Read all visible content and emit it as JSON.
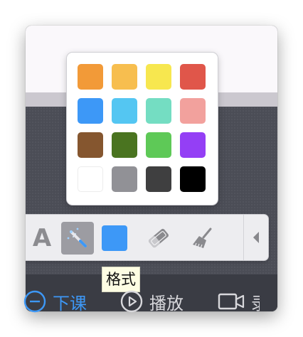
{
  "palette": {
    "colors": [
      "#f29a38",
      "#f7be4f",
      "#f7e74f",
      "#e0564a",
      "#3d98f7",
      "#54c6f2",
      "#74ddc2",
      "#f2a19d",
      "#85562f",
      "#4a7420",
      "#5ec957",
      "#943ff5",
      "#ffffff",
      "#919196",
      "#3f3f40",
      "#000000"
    ]
  },
  "toolbar": {
    "text_tool_glyph": "A",
    "current_color": "#3d98f7",
    "active_tool": "magic-wand"
  },
  "tooltip": {
    "text": "格式"
  },
  "bottom_bar": {
    "end_class_label": "下课",
    "play_label": "播放",
    "record_label": "录制"
  },
  "colors": {
    "accent": "#3d98f7",
    "bottom_bar_text": "#d8d8dc"
  }
}
